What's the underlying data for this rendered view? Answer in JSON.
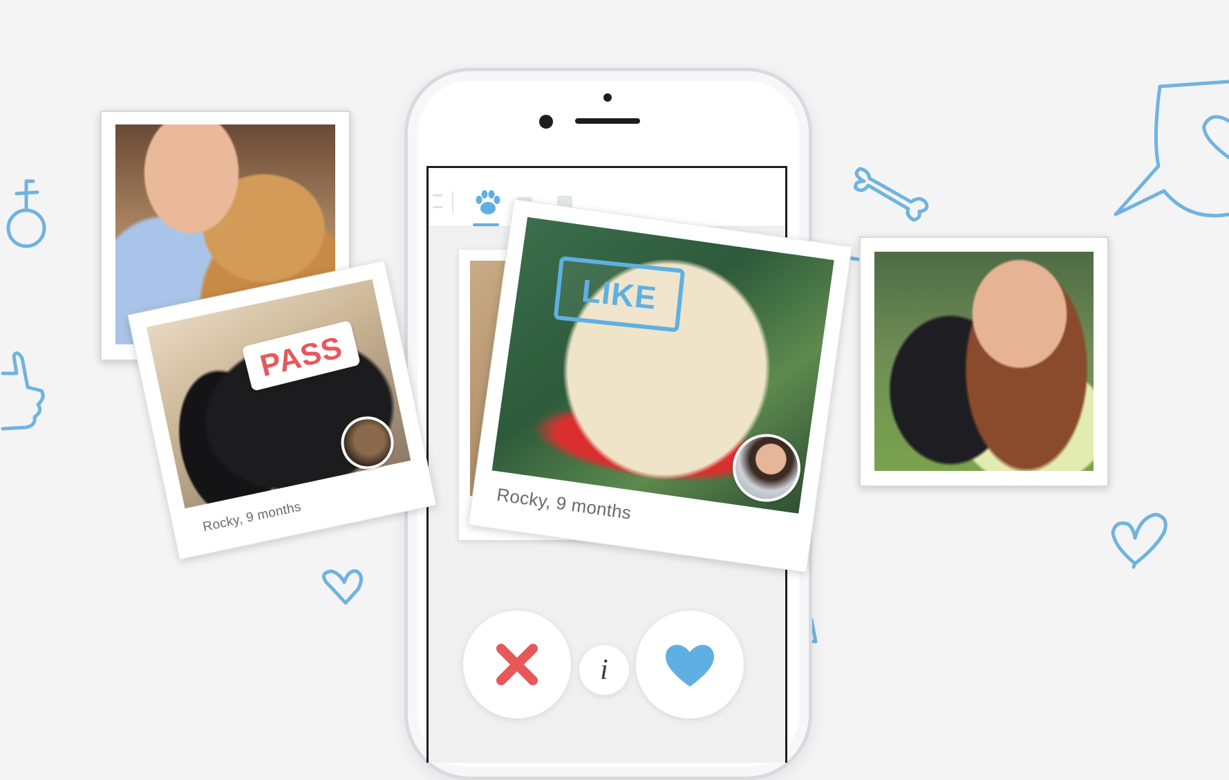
{
  "stamps": {
    "pass": "PASS",
    "like": "LIKE"
  },
  "cards": {
    "pass": {
      "caption": "Rocky, 9 months"
    },
    "like": {
      "caption": "Rocky, 9 months"
    }
  },
  "actions": {
    "info_label": "i",
    "pass_icon": "x-icon",
    "like_icon": "heart-icon"
  },
  "tabs": [
    "menu",
    "paw",
    "chat",
    "list"
  ],
  "colors": {
    "accent_blue": "#5fb0e2",
    "pass_red": "#e8585a",
    "background": "#f4f4f5"
  }
}
